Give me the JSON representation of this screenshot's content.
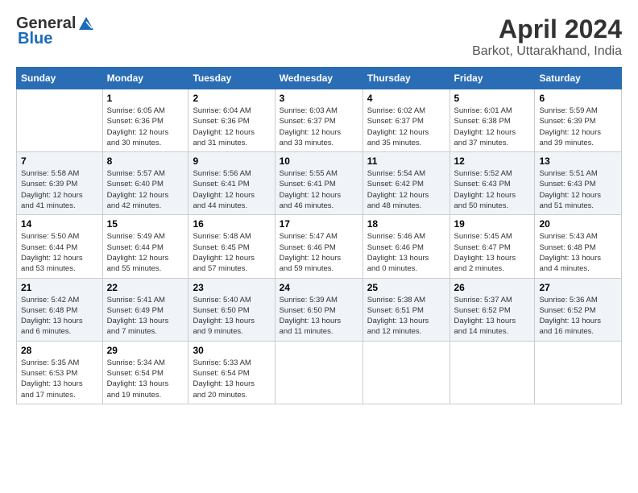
{
  "header": {
    "logo_general": "General",
    "logo_blue": "Blue",
    "title": "April 2024",
    "location": "Barkot, Uttarakhand, India"
  },
  "columns": [
    "Sunday",
    "Monday",
    "Tuesday",
    "Wednesday",
    "Thursday",
    "Friday",
    "Saturday"
  ],
  "weeks": [
    [
      {
        "day": "",
        "info": ""
      },
      {
        "day": "1",
        "info": "Sunrise: 6:05 AM\nSunset: 6:36 PM\nDaylight: 12 hours\nand 30 minutes."
      },
      {
        "day": "2",
        "info": "Sunrise: 6:04 AM\nSunset: 6:36 PM\nDaylight: 12 hours\nand 31 minutes."
      },
      {
        "day": "3",
        "info": "Sunrise: 6:03 AM\nSunset: 6:37 PM\nDaylight: 12 hours\nand 33 minutes."
      },
      {
        "day": "4",
        "info": "Sunrise: 6:02 AM\nSunset: 6:37 PM\nDaylight: 12 hours\nand 35 minutes."
      },
      {
        "day": "5",
        "info": "Sunrise: 6:01 AM\nSunset: 6:38 PM\nDaylight: 12 hours\nand 37 minutes."
      },
      {
        "day": "6",
        "info": "Sunrise: 5:59 AM\nSunset: 6:39 PM\nDaylight: 12 hours\nand 39 minutes."
      }
    ],
    [
      {
        "day": "7",
        "info": "Sunrise: 5:58 AM\nSunset: 6:39 PM\nDaylight: 12 hours\nand 41 minutes."
      },
      {
        "day": "8",
        "info": "Sunrise: 5:57 AM\nSunset: 6:40 PM\nDaylight: 12 hours\nand 42 minutes."
      },
      {
        "day": "9",
        "info": "Sunrise: 5:56 AM\nSunset: 6:41 PM\nDaylight: 12 hours\nand 44 minutes."
      },
      {
        "day": "10",
        "info": "Sunrise: 5:55 AM\nSunset: 6:41 PM\nDaylight: 12 hours\nand 46 minutes."
      },
      {
        "day": "11",
        "info": "Sunrise: 5:54 AM\nSunset: 6:42 PM\nDaylight: 12 hours\nand 48 minutes."
      },
      {
        "day": "12",
        "info": "Sunrise: 5:52 AM\nSunset: 6:43 PM\nDaylight: 12 hours\nand 50 minutes."
      },
      {
        "day": "13",
        "info": "Sunrise: 5:51 AM\nSunset: 6:43 PM\nDaylight: 12 hours\nand 51 minutes."
      }
    ],
    [
      {
        "day": "14",
        "info": "Sunrise: 5:50 AM\nSunset: 6:44 PM\nDaylight: 12 hours\nand 53 minutes."
      },
      {
        "day": "15",
        "info": "Sunrise: 5:49 AM\nSunset: 6:44 PM\nDaylight: 12 hours\nand 55 minutes."
      },
      {
        "day": "16",
        "info": "Sunrise: 5:48 AM\nSunset: 6:45 PM\nDaylight: 12 hours\nand 57 minutes."
      },
      {
        "day": "17",
        "info": "Sunrise: 5:47 AM\nSunset: 6:46 PM\nDaylight: 12 hours\nand 59 minutes."
      },
      {
        "day": "18",
        "info": "Sunrise: 5:46 AM\nSunset: 6:46 PM\nDaylight: 13 hours\nand 0 minutes."
      },
      {
        "day": "19",
        "info": "Sunrise: 5:45 AM\nSunset: 6:47 PM\nDaylight: 13 hours\nand 2 minutes."
      },
      {
        "day": "20",
        "info": "Sunrise: 5:43 AM\nSunset: 6:48 PM\nDaylight: 13 hours\nand 4 minutes."
      }
    ],
    [
      {
        "day": "21",
        "info": "Sunrise: 5:42 AM\nSunset: 6:48 PM\nDaylight: 13 hours\nand 6 minutes."
      },
      {
        "day": "22",
        "info": "Sunrise: 5:41 AM\nSunset: 6:49 PM\nDaylight: 13 hours\nand 7 minutes."
      },
      {
        "day": "23",
        "info": "Sunrise: 5:40 AM\nSunset: 6:50 PM\nDaylight: 13 hours\nand 9 minutes."
      },
      {
        "day": "24",
        "info": "Sunrise: 5:39 AM\nSunset: 6:50 PM\nDaylight: 13 hours\nand 11 minutes."
      },
      {
        "day": "25",
        "info": "Sunrise: 5:38 AM\nSunset: 6:51 PM\nDaylight: 13 hours\nand 12 minutes."
      },
      {
        "day": "26",
        "info": "Sunrise: 5:37 AM\nSunset: 6:52 PM\nDaylight: 13 hours\nand 14 minutes."
      },
      {
        "day": "27",
        "info": "Sunrise: 5:36 AM\nSunset: 6:52 PM\nDaylight: 13 hours\nand 16 minutes."
      }
    ],
    [
      {
        "day": "28",
        "info": "Sunrise: 5:35 AM\nSunset: 6:53 PM\nDaylight: 13 hours\nand 17 minutes."
      },
      {
        "day": "29",
        "info": "Sunrise: 5:34 AM\nSunset: 6:54 PM\nDaylight: 13 hours\nand 19 minutes."
      },
      {
        "day": "30",
        "info": "Sunrise: 5:33 AM\nSunset: 6:54 PM\nDaylight: 13 hours\nand 20 minutes."
      },
      {
        "day": "",
        "info": ""
      },
      {
        "day": "",
        "info": ""
      },
      {
        "day": "",
        "info": ""
      },
      {
        "day": "",
        "info": ""
      }
    ]
  ]
}
